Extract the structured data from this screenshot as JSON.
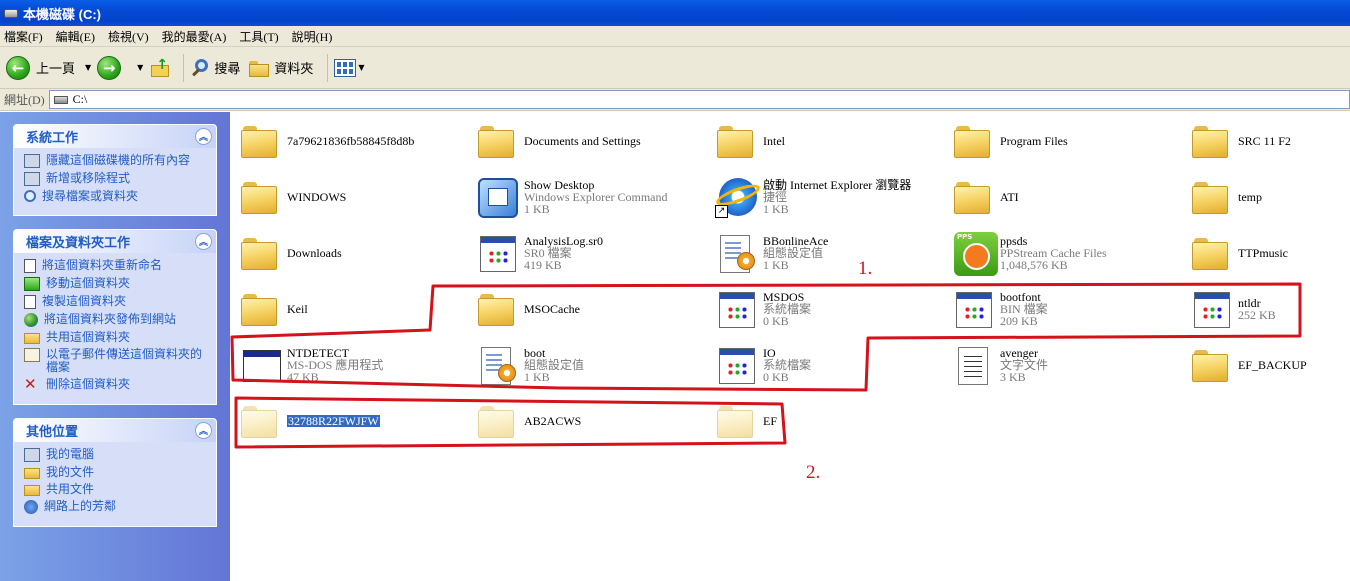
{
  "window": {
    "title": "本機磁碟 (C:)"
  },
  "menu": [
    "檔案(F)",
    "編輯(E)",
    "檢視(V)",
    "我的最愛(A)",
    "工具(T)",
    "說明(H)"
  ],
  "toolbar": {
    "back_label": "上一頁",
    "search_label": "搜尋",
    "folders_label": "資料夾"
  },
  "address": {
    "label": "網址(D)",
    "value": "C:\\"
  },
  "sidebar": {
    "system_tasks": {
      "title": "系統工作",
      "items": [
        "隱藏這個磁碟機的所有內容",
        "新增或移除程式",
        "搜尋檔案或資料夾"
      ]
    },
    "file_tasks": {
      "title": "檔案及資料夾工作",
      "items": [
        "將這個資料夾重新命名",
        "移動這個資料夾",
        "複製這個資料夾",
        "將這個資料夾發佈到網站",
        "共用這個資料夾",
        "以電子郵件傳送這個資料夾的檔案",
        "刪除這個資料夾"
      ]
    },
    "other_places": {
      "title": "其他位置",
      "items": [
        "我的電腦",
        "我的文件",
        "共用文件",
        "網路上的芳鄰"
      ]
    }
  },
  "files": [
    {
      "name": "7a79621836fb58845f8d8b",
      "type": "",
      "size": "",
      "icon": "folder-icon"
    },
    {
      "name": "Documents and Settings",
      "type": "",
      "size": "",
      "icon": "folder-icon"
    },
    {
      "name": "Intel",
      "type": "",
      "size": "",
      "icon": "folder-icon"
    },
    {
      "name": "Program Files",
      "type": "",
      "size": "",
      "icon": "folder-icon"
    },
    {
      "name": "SRC 11 F2",
      "type": "",
      "size": "",
      "icon": "folder-icon"
    },
    {
      "name": "WINDOWS",
      "type": "",
      "size": "",
      "icon": "folder-icon"
    },
    {
      "name": "Show Desktop",
      "type": "Windows Explorer Command",
      "size": "1 KB",
      "icon": "show-desktop-icon"
    },
    {
      "name": "啟動 Internet Explorer 瀏覽器",
      "type": "捷徑",
      "size": "1 KB",
      "icon": "internet-explorer-icon"
    },
    {
      "name": "ATI",
      "type": "",
      "size": "",
      "icon": "folder-icon"
    },
    {
      "name": "temp",
      "type": "",
      "size": "",
      "icon": "folder-icon"
    },
    {
      "name": "Downloads",
      "type": "",
      "size": "",
      "icon": "folder-icon"
    },
    {
      "name": "AnalysisLog.sr0",
      "type": "SR0 檔案",
      "size": "419 KB",
      "icon": "system-file-icon"
    },
    {
      "name": "BBonlineAce",
      "type": "組態設定值",
      "size": "1 KB",
      "icon": "config-file-icon"
    },
    {
      "name": "ppsds",
      "type": "PPStream Cache Files",
      "size": "1,048,576 KB",
      "icon": "ppstream-icon"
    },
    {
      "name": "TTPmusic",
      "type": "",
      "size": "",
      "icon": "folder-icon"
    },
    {
      "name": "Keil",
      "type": "",
      "size": "",
      "icon": "folder-icon"
    },
    {
      "name": "MSOCache",
      "type": "",
      "size": "",
      "icon": "folder-icon"
    },
    {
      "name": "MSDOS",
      "type": "系統檔案",
      "size": "0 KB",
      "icon": "system-file-icon"
    },
    {
      "name": "bootfont",
      "type": "BIN 檔案",
      "size": "209 KB",
      "icon": "system-file-icon"
    },
    {
      "name": "ntldr",
      "type": "",
      "size": "252 KB",
      "icon": "system-file-icon"
    },
    {
      "name": "NTDETECT",
      "type": "MS-DOS 應用程式",
      "size": "47 KB",
      "icon": "dos-app-icon"
    },
    {
      "name": "boot",
      "type": "組態設定值",
      "size": "1 KB",
      "icon": "config-file-icon"
    },
    {
      "name": "IO",
      "type": "系統檔案",
      "size": "0 KB",
      "icon": "system-file-icon"
    },
    {
      "name": "avenger",
      "type": "文字文件",
      "size": "3 KB",
      "icon": "text-file-icon"
    },
    {
      "name": "EF_BACKUP",
      "type": "",
      "size": "",
      "icon": "folder-icon"
    },
    {
      "name": "32788R22FWJFW",
      "type": "",
      "size": "",
      "icon": "hidden-folder-icon",
      "selected": true
    },
    {
      "name": "AB2ACWS",
      "type": "",
      "size": "",
      "icon": "hidden-folder-icon"
    },
    {
      "name": "EF",
      "type": "",
      "size": "",
      "icon": "hidden-folder-icon"
    }
  ],
  "annotations": {
    "label1": "1.",
    "label2": "2."
  },
  "colors": {
    "titlebar": "#0549d5",
    "sidebar_link": "#215dc6",
    "annotation": "#d4121a",
    "selection": "#316ac5"
  }
}
